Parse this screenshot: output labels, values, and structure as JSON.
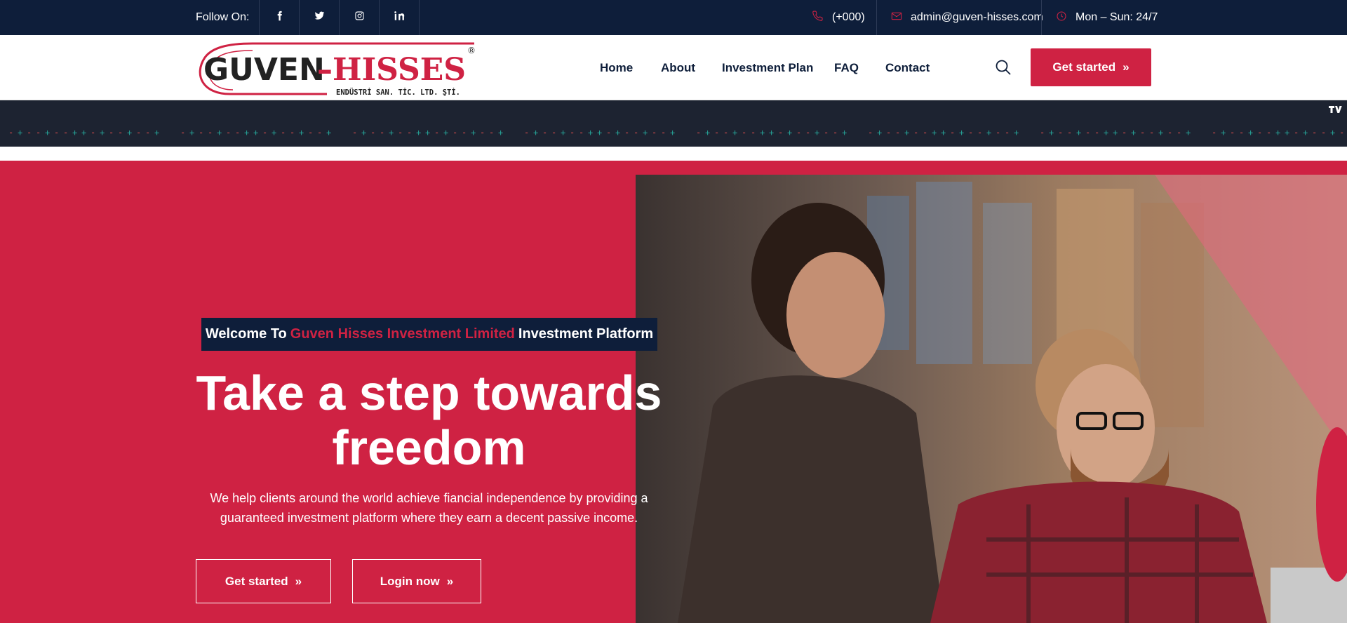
{
  "topbar": {
    "follow_label": "Follow On:",
    "socials": [
      "facebook-icon",
      "twitter-icon",
      "instagram-icon",
      "linkedin-icon"
    ],
    "phone": "(+000)",
    "email": "admin@guven-hisses.com",
    "hours": "Mon – Sun: 24/7"
  },
  "header": {
    "logo": {
      "brand_dark": "GUVEN",
      "dash": "–",
      "brand_red": "HISSES",
      "subtitle": "ENDÜSTRİ SAN. TİC. LTD. ŞTİ.",
      "registered": "®"
    },
    "nav": [
      "Home",
      "About",
      "Investment Plan",
      "FAQ",
      "Contact"
    ],
    "cta": "Get started",
    "cta_chevron": "»"
  },
  "ticker": {
    "widget_logo": "tradingview-logo"
  },
  "hero": {
    "welcome_pre": "Welcome To",
    "welcome_highlight": "Guven Hisses Investment Limited",
    "welcome_post": "Investment Platform",
    "headline_line1": "Take a step towards",
    "headline_line2": "freedom",
    "sub_line1": "We help clients around the world achieve fiancial independence by providing a",
    "sub_line2": "guaranteed investment platform where they earn a decent passive income.",
    "btn_primary": "Get started",
    "btn_secondary": "Login now",
    "chevron": "»"
  },
  "colors": {
    "navy": "#0e1e3a",
    "brand_red": "#cf2243",
    "ticker_bg": "#1d2331",
    "ticker_up": "#26a69a",
    "ticker_down": "#ef5350"
  }
}
